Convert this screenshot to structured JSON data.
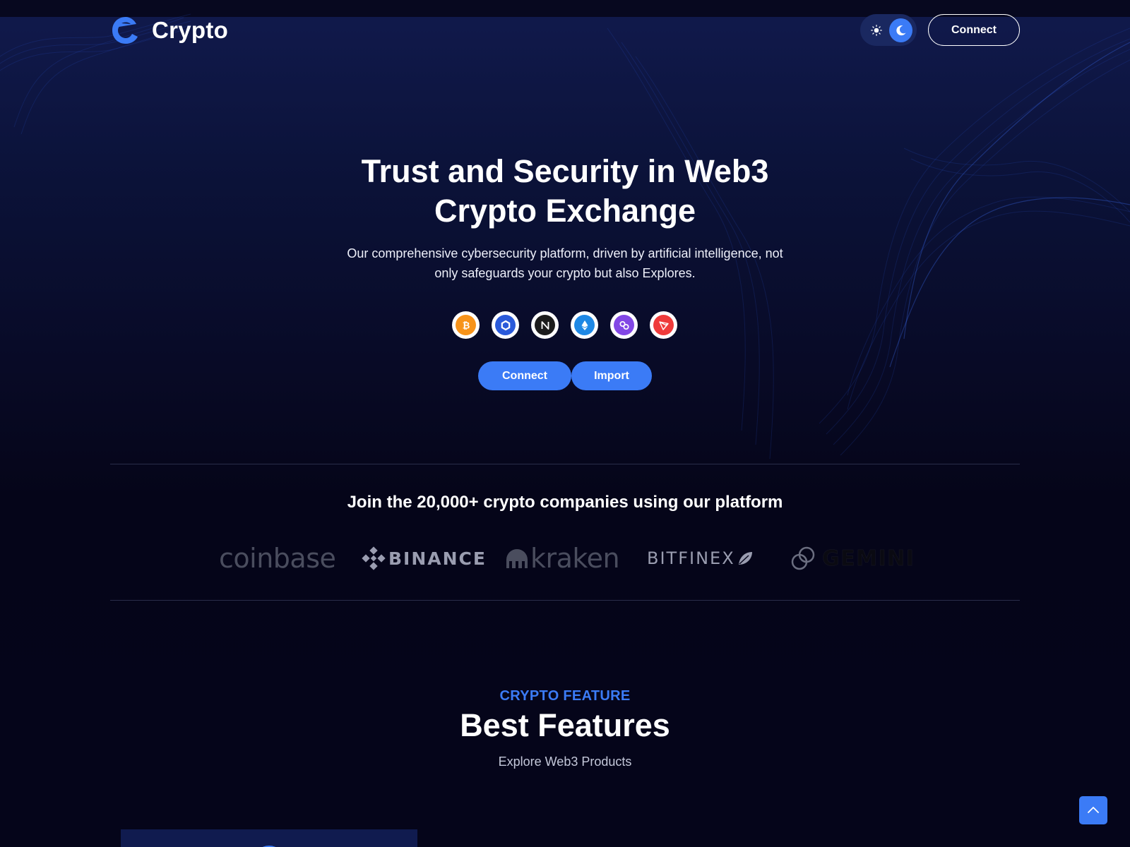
{
  "header": {
    "brand": "Crypto",
    "connect_label": "Connect"
  },
  "hero": {
    "title_line1": "Trust and Security in Web3",
    "title_line2": "Crypto Exchange",
    "subtitle_line1": "Our comprehensive cybersecurity platform, driven by artificial intelligence, not",
    "subtitle_line2": "only safeguards your crypto but also Explores.",
    "coins": [
      "bitcoin-icon",
      "chainlink-icon",
      "near-icon",
      "ethereum-icon",
      "polygon-icon",
      "tron-icon"
    ],
    "connect_label": "Connect",
    "import_label": "Import"
  },
  "partners": {
    "title": "Join the 20,000+ crypto companies using our platform",
    "logos": [
      "coinbase",
      "BINANCE",
      "kraken",
      "BITFINEX",
      "GEMINI"
    ]
  },
  "features": {
    "kicker": "CRYPTO FEATURE",
    "title": "Best Features",
    "subtitle": "Explore Web3 Products"
  },
  "colors": {
    "accent": "#3b7bf6",
    "background": "#05051a",
    "hero_top": "#111a4d"
  }
}
